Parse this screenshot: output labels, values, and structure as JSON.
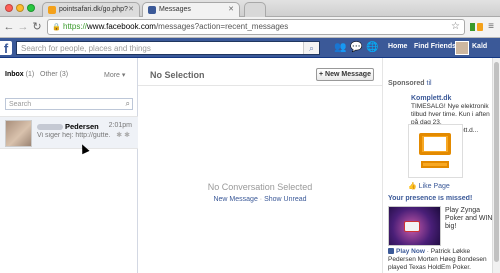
{
  "browser": {
    "tabs": [
      {
        "label": "pointsafari.dk/go.php?",
        "favicon_color": "#f4a11a"
      },
      {
        "label": "Messages",
        "favicon_color": "#3b5998"
      }
    ],
    "url": {
      "host": "www.facebook.com",
      "path": "/messages?action=recent_messages",
      "scheme": "https://"
    },
    "icons": [
      "back-icon",
      "forward-icon",
      "reload-icon",
      "lock-icon",
      "star-icon",
      "menu-icon"
    ]
  },
  "facebook": {
    "logo": "f",
    "search_placeholder": "Search for people, places and things",
    "nav": {
      "home": "Home",
      "find_friends": "Find Friends",
      "user": "Kald"
    },
    "colors": {
      "brand": "#3b5998",
      "link": "#3b5998"
    }
  },
  "inbox": {
    "folders": {
      "inbox_label": "Inbox",
      "inbox_count": "(1)",
      "other_label": "Other",
      "other_count": "(3)"
    },
    "more": "More ▾",
    "search_placeholder": "Search",
    "thread": {
      "name": "Pedersen",
      "time": "2:01pm",
      "snippet": "Vi siger hej: http://gutte..."
    }
  },
  "center": {
    "heading": "No Selection",
    "new_message_button": "+ New Message",
    "empty_title": "No Conversation Selected",
    "action_new": "New Message",
    "separator": "·",
    "action_unread": "Show Unread"
  },
  "sidebar": {
    "sponsored": "Sponsored",
    "sponsored_suffix": "til",
    "ad1": {
      "title": "Komplett.dk",
      "text": "TIMESALG! Nye elektronik tilbud hver time. Kun i aften på dag 23. http://www.komplett.d...",
      "like": "Like Page"
    },
    "ad2": {
      "title": "Your presence is missed!",
      "text": "Play Zynga Poker and WIN big!",
      "play_now": "Play Now",
      "footer": "· Patrick Løkke Pedersen Morten Høeg Bondesen played Texas HoldEm Poker."
    }
  }
}
